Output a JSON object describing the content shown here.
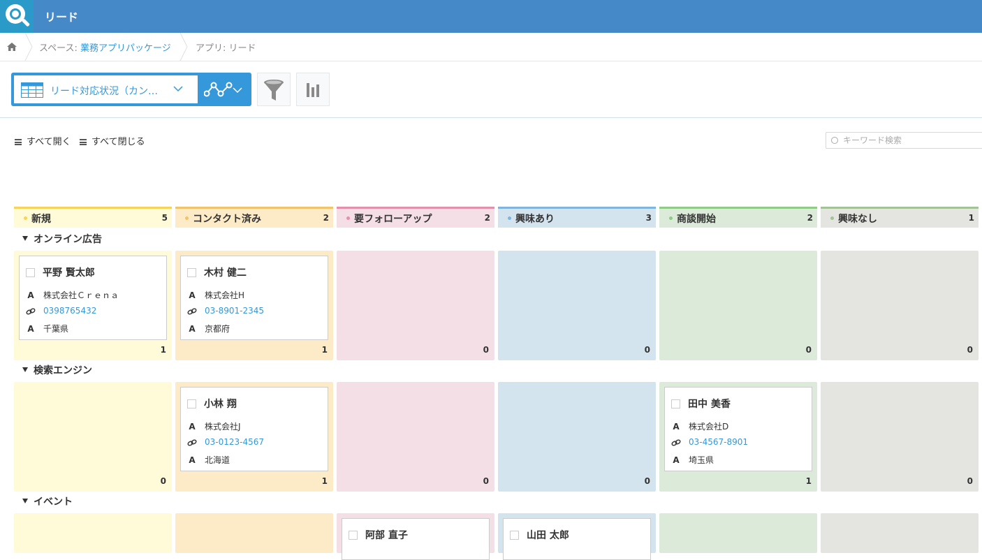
{
  "app": {
    "title": "リード"
  },
  "breadcrumb": {
    "space_prefix": "スペース: ",
    "space_name": "業務アプリパッケージ",
    "app_label": "アプリ: リード"
  },
  "toolbar": {
    "view_name": "リード対応状況（カン…"
  },
  "controls": {
    "expand_all": "すべて開く",
    "collapse_all": "すべて閉じる",
    "search_placeholder": "キーワード検索"
  },
  "columns": [
    {
      "title": "新規",
      "count": "5",
      "accent": "#f7d35a",
      "bg": "#fffbd8"
    },
    {
      "title": "コンタクト済み",
      "count": "2",
      "accent": "#f2c46a",
      "bg": "#fdebc7"
    },
    {
      "title": "要フォローアップ",
      "count": "2",
      "accent": "#e58fae",
      "bg": "#f5dfe6"
    },
    {
      "title": "興味あり",
      "count": "3",
      "accent": "#7fb4df",
      "bg": "#d3e4ef"
    },
    {
      "title": "商談開始",
      "count": "2",
      "accent": "#8fca86",
      "bg": "#dcebd9"
    },
    {
      "title": "興味なし",
      "count": "1",
      "accent": "#a3c296",
      "bg": "#e4e5e1"
    }
  ],
  "groups": [
    {
      "title": "オンライン広告",
      "counts": [
        "1",
        "1",
        "0",
        "0",
        "0",
        "0"
      ]
    },
    {
      "title": "検索エンジン",
      "counts": [
        "0",
        "1",
        "0",
        "0",
        "1",
        "0"
      ]
    },
    {
      "title": "イベント",
      "counts": [
        "",
        "",
        "",
        "",
        "",
        ""
      ]
    }
  ],
  "cards": [
    {
      "name": "平野 賢太郎",
      "company": "株式会社Ｃｒｅｎａ",
      "phone": "0398765432",
      "prefecture": "千葉県"
    },
    {
      "name": "木村 健二",
      "company": "株式会社H",
      "phone": "03-8901-2345",
      "prefecture": "京都府"
    },
    {
      "name": "小林 翔",
      "company": "株式会社J",
      "phone": "03-0123-4567",
      "prefecture": "北海道"
    },
    {
      "name": "田中 美香",
      "company": "株式会社D",
      "phone": "03-4567-8901",
      "prefecture": "埼玉県"
    },
    {
      "name": "阿部 直子"
    },
    {
      "name": "山田 太郎"
    }
  ],
  "icons": {
    "text_field": "A",
    "link_field": "link-icon"
  }
}
